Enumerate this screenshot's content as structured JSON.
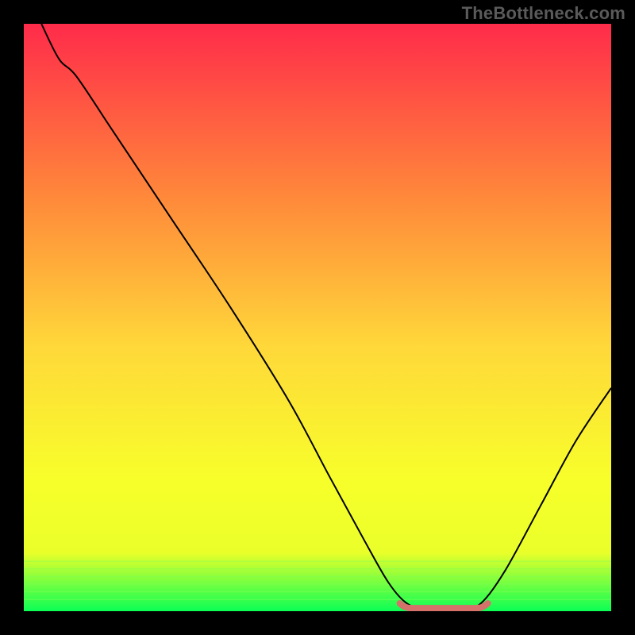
{
  "watermark": "TheBottleneck.com",
  "chart_data": {
    "type": "line",
    "title": "",
    "xlabel": "",
    "ylabel": "",
    "x_range": [
      0,
      100
    ],
    "y_range": [
      0,
      100
    ],
    "background_gradient": [
      "#ff2b4a",
      "#ff8a3a",
      "#ffd83a",
      "#f7ff2a",
      "#eaff2a",
      "#0bff55"
    ],
    "series": [
      {
        "name": "bottleneck-curve",
        "color": "#000000",
        "points": [
          {
            "x": 3,
            "y": 100
          },
          {
            "x": 6,
            "y": 94
          },
          {
            "x": 9,
            "y": 91
          },
          {
            "x": 15,
            "y": 82
          },
          {
            "x": 25,
            "y": 67
          },
          {
            "x": 35,
            "y": 52
          },
          {
            "x": 45,
            "y": 36
          },
          {
            "x": 52,
            "y": 23
          },
          {
            "x": 58,
            "y": 12
          },
          {
            "x": 62,
            "y": 5
          },
          {
            "x": 65,
            "y": 1.5
          },
          {
            "x": 68,
            "y": 0.5
          },
          {
            "x": 75,
            "y": 0.5
          },
          {
            "x": 78,
            "y": 1.5
          },
          {
            "x": 82,
            "y": 7
          },
          {
            "x": 88,
            "y": 18
          },
          {
            "x": 94,
            "y": 29
          },
          {
            "x": 100,
            "y": 38
          }
        ]
      }
    ],
    "highlight": {
      "name": "optimal-range",
      "color": "#d6706b",
      "x_start": 64,
      "x_end": 79,
      "y": 0.8
    }
  }
}
